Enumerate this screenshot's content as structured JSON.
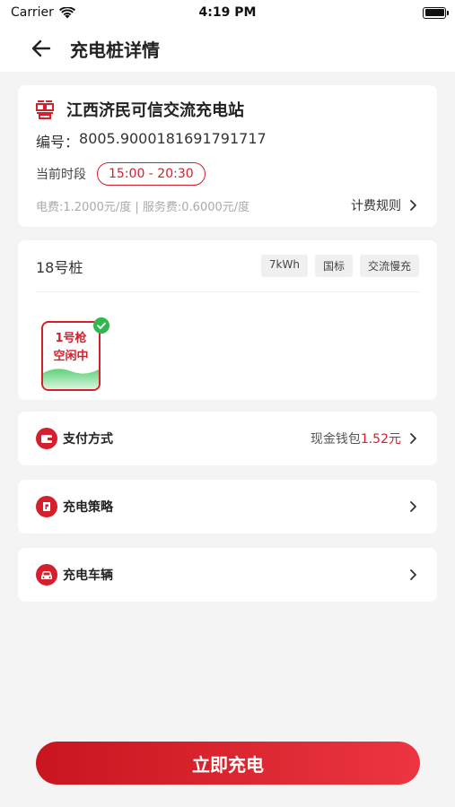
{
  "status_bar": {
    "carrier": "Carrier",
    "time": "4:19 PM"
  },
  "nav": {
    "title": "充电桩详情"
  },
  "station": {
    "name": "江西济民可信交流充电站",
    "code_label": "编号：",
    "code": "8005.9000181691791717",
    "period_label": "当前时段",
    "period": "15:00 - 20:30",
    "fee_text": "电费:1.2000元/度 | 服务费:0.6000元/度",
    "fee_rule": "计费规则"
  },
  "pile": {
    "name": "18号桩",
    "tags": [
      "7kWh",
      "国标",
      "交流慢充"
    ],
    "gun": {
      "name": "1号枪",
      "status": "空闲中"
    }
  },
  "payment": {
    "label": "支付方式",
    "value_prefix": "现金钱包",
    "amount": "1.52元"
  },
  "strategy": {
    "label": "充电策略"
  },
  "vehicle": {
    "label": "充电车辆"
  },
  "charge_button": "立即充电",
  "colors": {
    "accent": "#d4202c",
    "success": "#2fb84f"
  }
}
